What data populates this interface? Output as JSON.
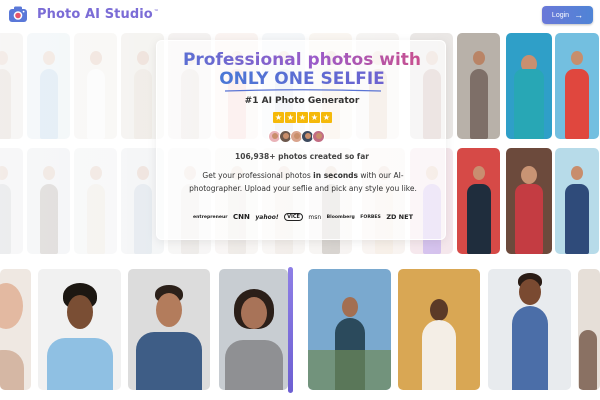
{
  "header": {
    "brand": "Photo AI Studio",
    "brand_mark": "™",
    "login_label": "Login",
    "logo_icon": "camera-icon",
    "login_icon": "arrow-right-icon"
  },
  "hero": {
    "title_line1": "Professional photos with",
    "title_line2": "ONLY ONE SELFIE",
    "tagline": "#1 AI Photo Generator",
    "rating_stars": 5,
    "photos_count": "106,938+ photos created so far",
    "description_pre": "Get your professional photos ",
    "description_bold": "in seconds",
    "description_post": " with our AI-photographer. Upload your seflie and pick any style you like.",
    "press": [
      "entrepreneur",
      "CNN",
      "yahoo!",
      "VICE",
      "msn",
      "Bloomberg",
      "FORBES",
      "ZD NET"
    ]
  },
  "colors": {
    "brand": "#7b6cd6",
    "title_gradient_start": "#5b6fd3",
    "title_gradient_end": "#c8508f",
    "login_bg": "#5a7fd6",
    "star": "#f5b90a",
    "scroll_indicator": "#7f70de"
  }
}
